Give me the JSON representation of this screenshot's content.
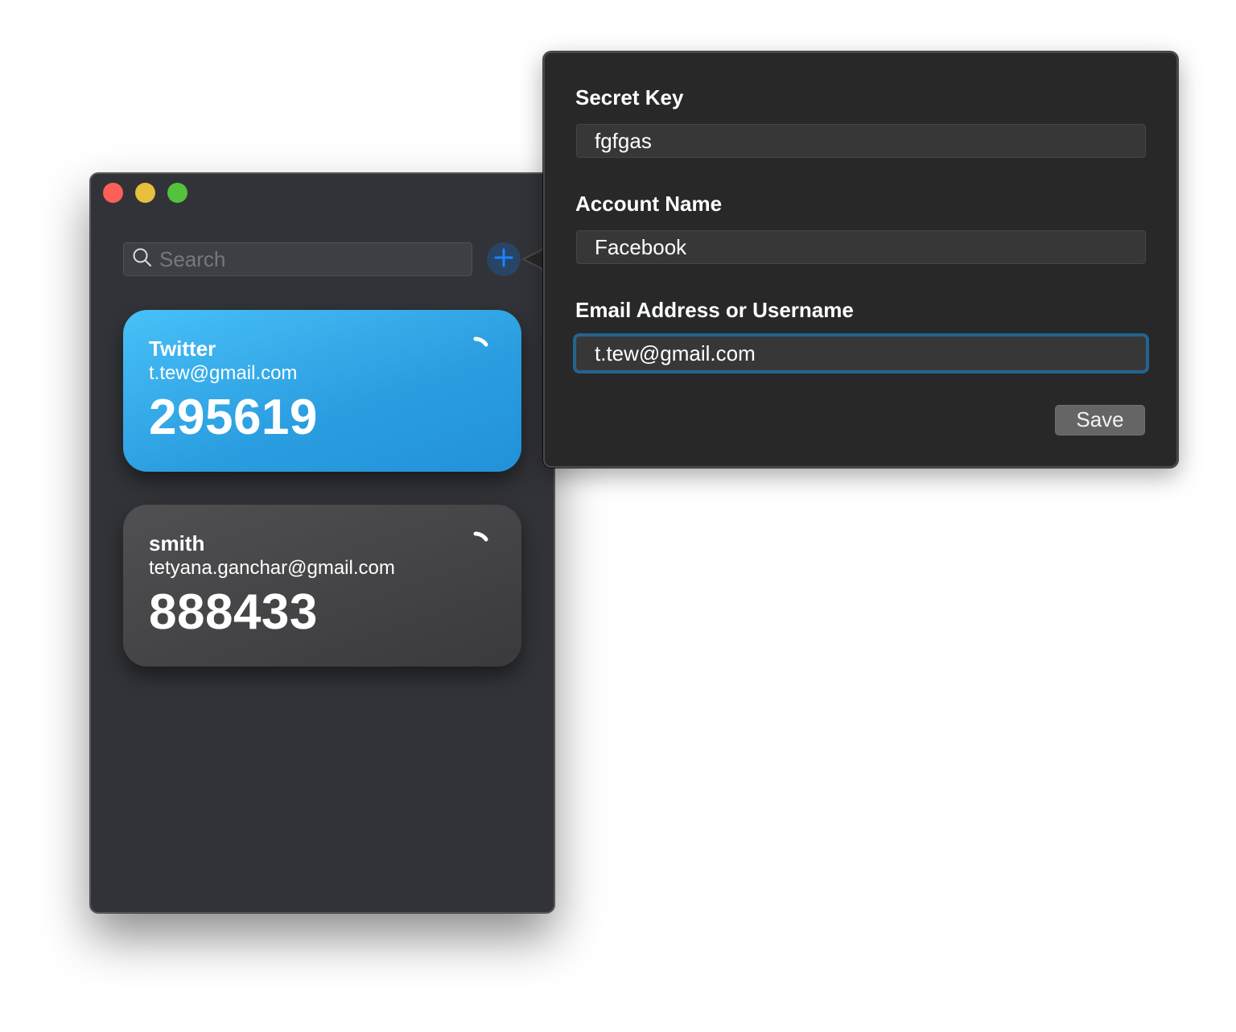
{
  "window": {
    "traffic_lights": {
      "close": "#fe5f57",
      "minimize": "#e6bf3b",
      "maximize": "#54c23d"
    },
    "search": {
      "placeholder": "Search",
      "value": "",
      "icon": "search-icon"
    },
    "add_button": {
      "icon": "plus-icon",
      "accent": "#1a84ff"
    },
    "accounts": [
      {
        "name": "Twitter",
        "email": "t.tew@gmail.com",
        "code": "295619",
        "selected": true,
        "timer_icon": "countdown-timer-icon"
      },
      {
        "name": "smith",
        "email": "tetyana.ganchar@gmail.com",
        "code": "888433",
        "selected": false,
        "timer_icon": "countdown-timer-icon"
      }
    ]
  },
  "popover": {
    "fields": [
      {
        "label": "Secret Key",
        "value": "fgfgas"
      },
      {
        "label": "Account Name",
        "value": "Facebook"
      },
      {
        "label": "Email Address or Username",
        "value": "t.tew@gmail.com",
        "focused": true
      }
    ],
    "save_label": "Save"
  }
}
